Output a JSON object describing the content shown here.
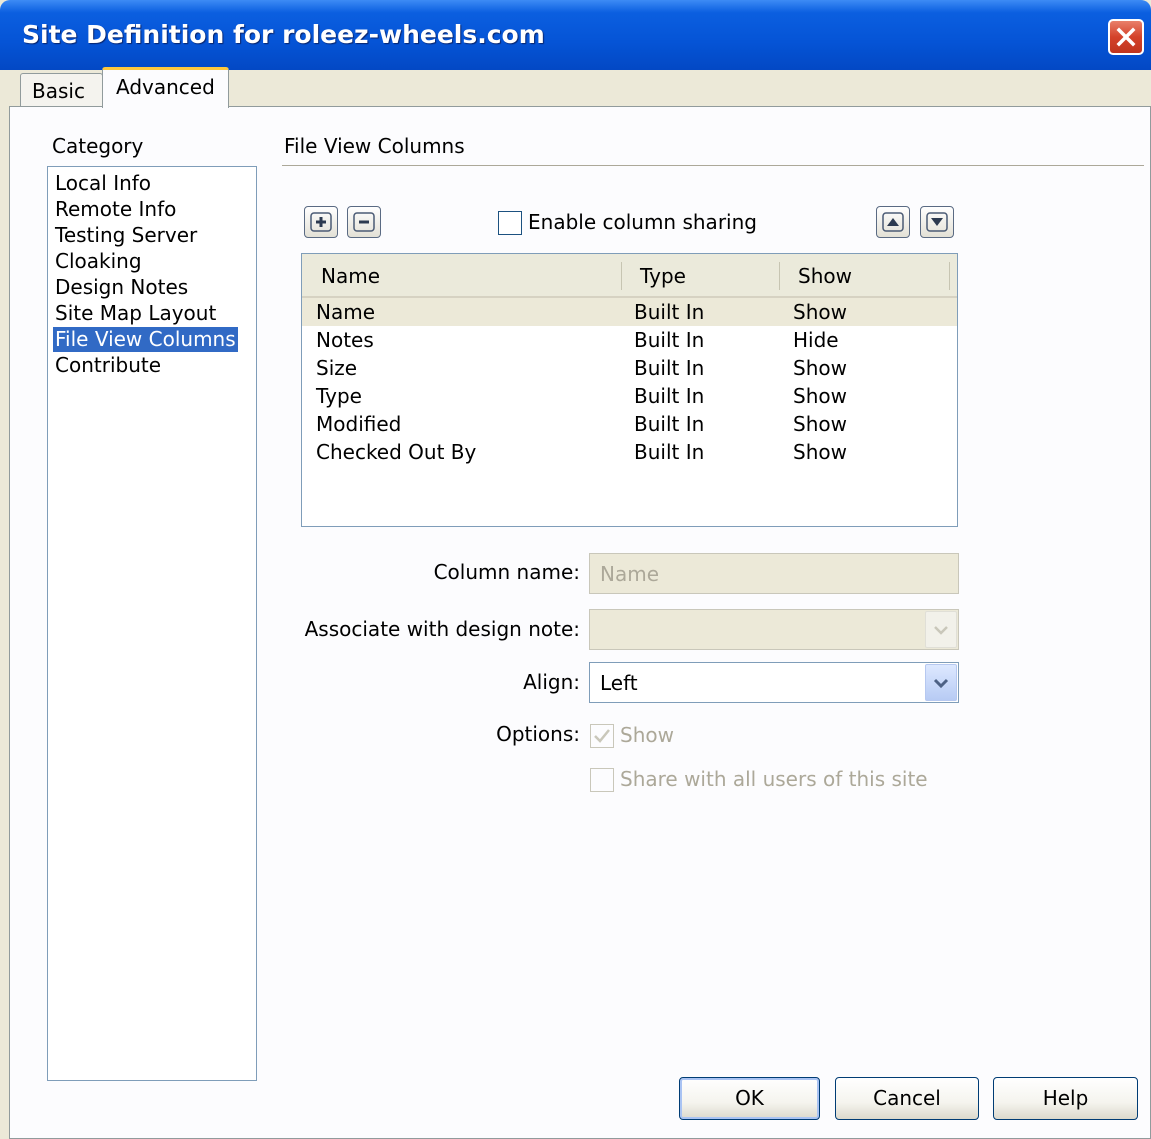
{
  "window": {
    "title": "Site Definition for roleez-wheels.com"
  },
  "tabs": [
    {
      "label": "Basic"
    },
    {
      "label": "Advanced"
    }
  ],
  "category": {
    "label": "Category",
    "items": [
      "Local Info",
      "Remote Info",
      "Testing Server",
      "Cloaking",
      "Design Notes",
      "Site Map Layout",
      "File View Columns",
      "Contribute"
    ],
    "selected": "File View Columns"
  },
  "section": {
    "title": "File View Columns"
  },
  "toolbar": {
    "enable_sharing_label": "Enable column sharing"
  },
  "table": {
    "headers": [
      "Name",
      "Type",
      "Show"
    ],
    "rows": [
      [
        "Name",
        "Built In",
        "Show"
      ],
      [
        "Notes",
        "Built In",
        "Hide"
      ],
      [
        "Size",
        "Built In",
        "Show"
      ],
      [
        "Type",
        "Built In",
        "Show"
      ],
      [
        "Modified",
        "Built In",
        "Show"
      ],
      [
        "Checked Out By",
        "Built In",
        "Show"
      ]
    ]
  },
  "form": {
    "column_name_label": "Column name:",
    "column_name_value": "Name",
    "associate_label": "Associate with design note:",
    "associate_value": "",
    "align_label": "Align:",
    "align_value": "Left",
    "options_label": "Options:",
    "show_label": "Show",
    "share_label": "Share with all users of this site"
  },
  "buttons": {
    "ok": "OK",
    "cancel": "Cancel",
    "help": "Help"
  }
}
